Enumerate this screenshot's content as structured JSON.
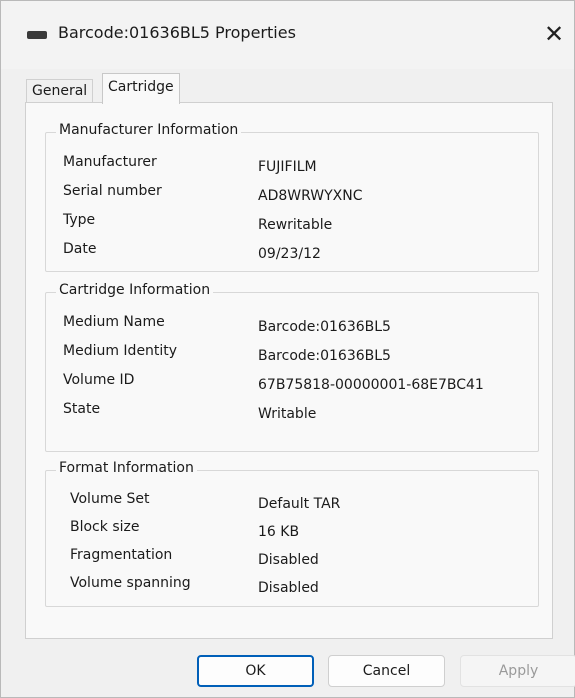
{
  "window": {
    "title": "Barcode:01636BL5 Properties",
    "close_label": "✕",
    "icon": "tape-drive-icon"
  },
  "tabs": [
    {
      "label": "General",
      "active": false
    },
    {
      "label": "Cartridge",
      "active": true
    }
  ],
  "manufacturer": {
    "title": "Manufacturer Information",
    "rows": [
      {
        "label": "Manufacturer",
        "value": "FUJIFILM"
      },
      {
        "label": "Serial number",
        "value": "AD8WRWYXNC"
      },
      {
        "label": "Type",
        "value": "Rewritable"
      },
      {
        "label": "Date",
        "value": "09/23/12"
      }
    ]
  },
  "cartridge": {
    "title": "Cartridge Information",
    "rows": [
      {
        "label": "Medium Name",
        "value": "Barcode:01636BL5"
      },
      {
        "label": "Medium Identity",
        "value": "Barcode:01636BL5"
      },
      {
        "label": "Volume ID",
        "value": "67B75818-00000001-68E7BC41"
      },
      {
        "label": "State",
        "value": "Writable"
      }
    ]
  },
  "format": {
    "title": "Format Information",
    "rows": [
      {
        "label": "Volume Set",
        "value": "Default TAR"
      },
      {
        "label": "Block size",
        "value": "16 KB"
      },
      {
        "label": "Fragmentation",
        "value": "Disabled"
      },
      {
        "label": "Volume spanning",
        "value": "Disabled"
      }
    ]
  },
  "buttons": {
    "ok": "OK",
    "cancel": "Cancel",
    "apply": "Apply"
  },
  "colors": {
    "accent": "#005fb8",
    "background": "#f0f0f0",
    "panel": "#f9f9f9"
  }
}
